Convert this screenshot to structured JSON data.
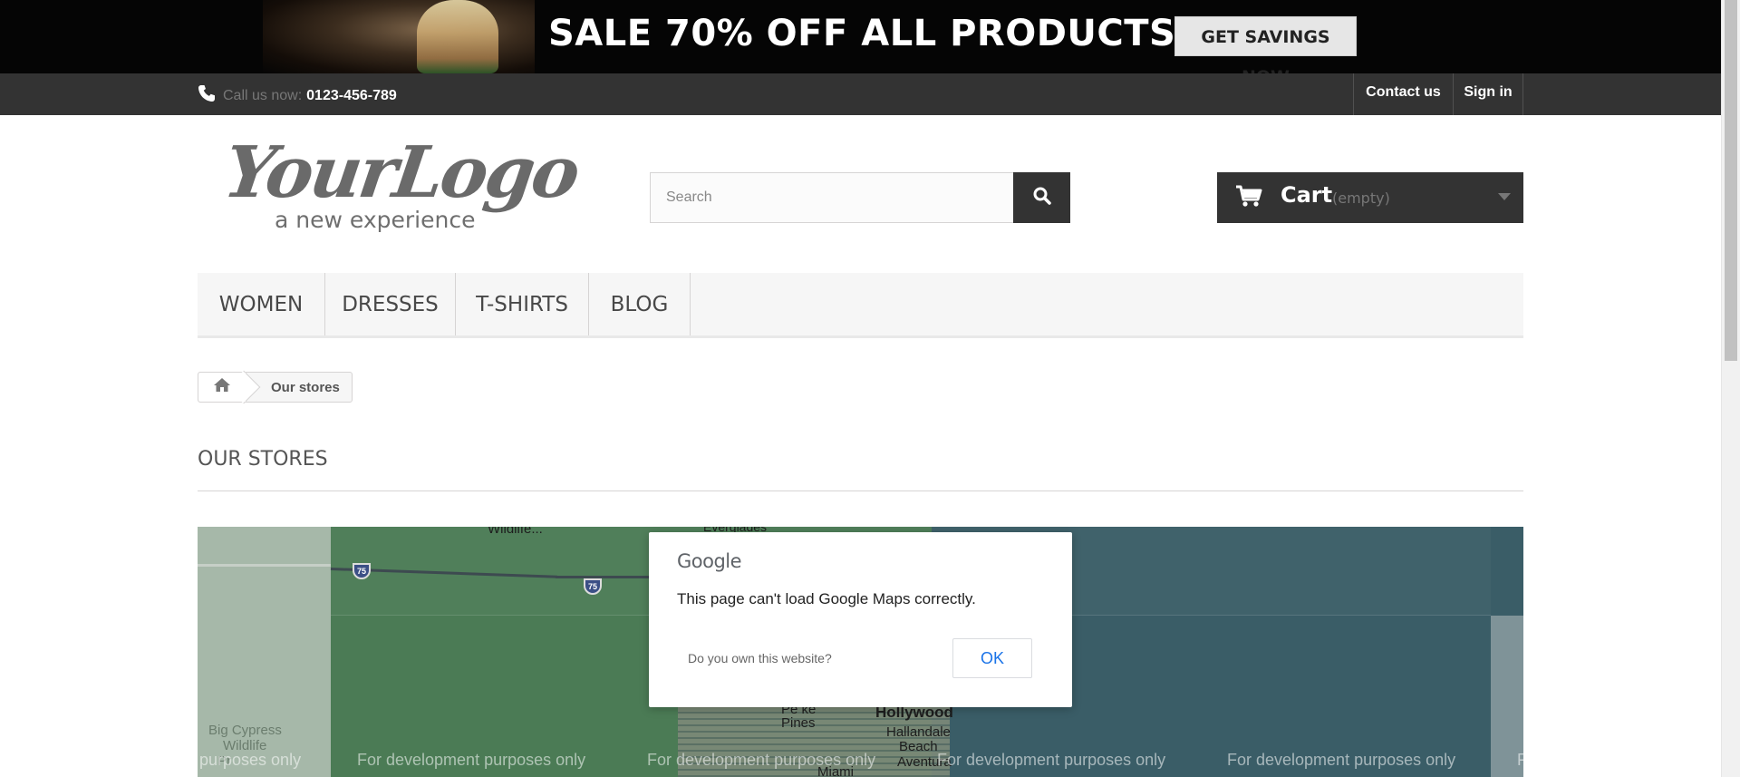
{
  "promo": {
    "headline": "SALE 70% OFF ALL PRODUCTS",
    "button_label": "GET SAVINGS NOW"
  },
  "topbar": {
    "call_label": "Call us now:",
    "phone_number": "0123-456-789",
    "links": [
      {
        "label": "Contact us",
        "icon": "none"
      },
      {
        "label": "Sign in",
        "icon": "none"
      }
    ],
    "icons": {
      "phone": "phone-icon"
    }
  },
  "header": {
    "logo_main": "YourLogo",
    "logo_tagline": "a new experience",
    "search_placeholder": "Search",
    "search_icon": "search-icon",
    "cart": {
      "label": "Cart",
      "status": "(empty)",
      "icon": "cart-icon"
    }
  },
  "menu": {
    "items": [
      "WOMEN",
      "DRESSES",
      "T-SHIRTS",
      "BLOG"
    ]
  },
  "breadcrumb": {
    "home_icon": "home-icon",
    "current": "Our stores"
  },
  "page": {
    "title": "OUR STORES"
  },
  "map": {
    "labels": {
      "wildlife_top": "Wildlife...",
      "everglades": "Everglades",
      "hollywood": "Hollywood",
      "hallandale": "Hallandale",
      "beach": "Beach",
      "aventura": "Aventura",
      "pembroke": "Pe      ke",
      "pines": "Pines",
      "miami": "Miami",
      "big_cypress_1": "Big Cypress",
      "big_cypress_2": "Wildlife",
      "big_cypress_3": "Pr"
    },
    "highway_75": "75",
    "watermark": "For development purposes only",
    "watermark_left": "purposes only",
    "watermark_right": "F"
  },
  "dialog": {
    "brand": "Google",
    "message": "This page can't load Google Maps correctly.",
    "own_question": "Do you own this website?",
    "ok_label": "OK"
  },
  "colors": {
    "topbar_bg": "#333333",
    "cart_bg": "#333333",
    "link_blue": "#1a73e8",
    "menu_bg": "#f6f6f6"
  }
}
